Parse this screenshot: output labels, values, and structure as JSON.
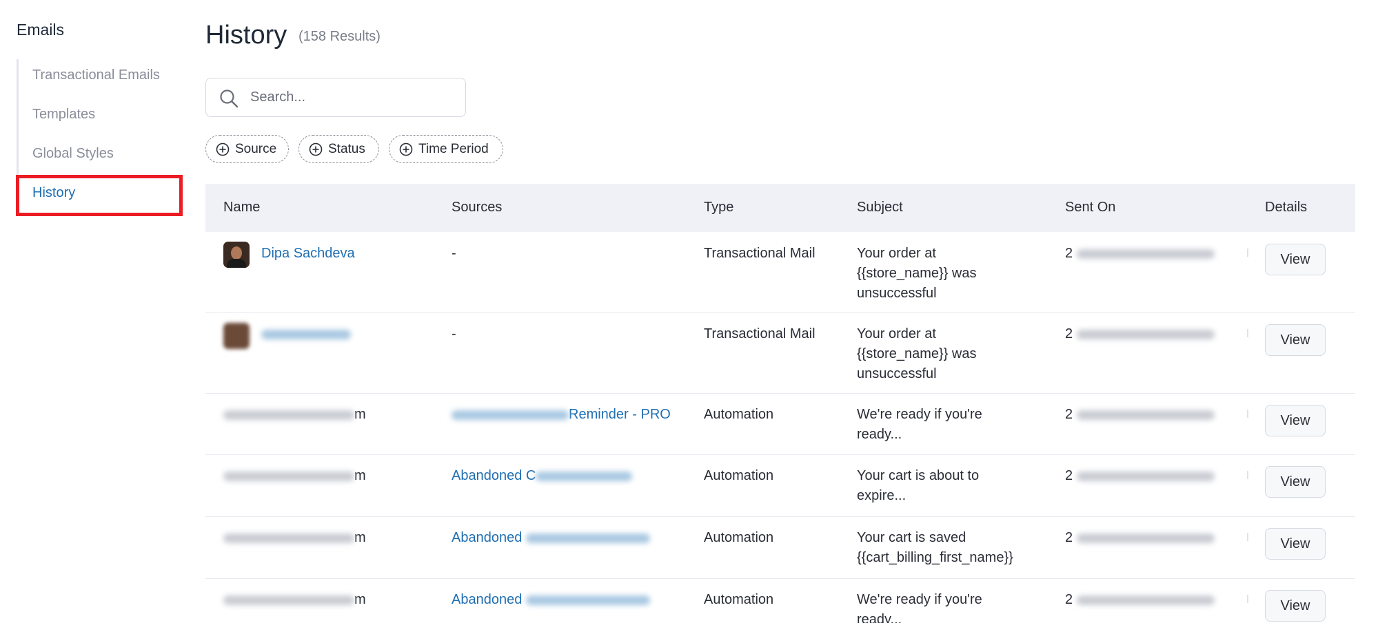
{
  "sidebar": {
    "heading": "Emails",
    "items": [
      {
        "label": "Transactional Emails",
        "active": false
      },
      {
        "label": "Templates",
        "active": false
      },
      {
        "label": "Global Styles",
        "active": false
      },
      {
        "label": "History",
        "active": true
      }
    ]
  },
  "header": {
    "title": "History",
    "count": "(158 Results)"
  },
  "search": {
    "placeholder": "Search..."
  },
  "filters": [
    {
      "label": "Source",
      "icon": "plus-circle-icon"
    },
    {
      "label": "Status",
      "icon": "plus-circle-icon"
    },
    {
      "label": "Time Period",
      "icon": "plus-circle-icon"
    }
  ],
  "table": {
    "columns": [
      "Name",
      "Sources",
      "Type",
      "Subject",
      "Sent On",
      "Details"
    ],
    "rows": [
      {
        "name": "Dipa Sachdeva",
        "name_suffix": "",
        "source": "-",
        "source_prefix": "",
        "source_suffix": "",
        "type": "Transactional Mail",
        "subject": [
          "Your order at",
          "{{store_name}} was",
          "unsuccessful"
        ],
        "sent_prefix": "2",
        "details": "View"
      },
      {
        "name": "",
        "name_suffix": "",
        "source": "-",
        "source_prefix": "",
        "source_suffix": "",
        "type": "Transactional Mail",
        "subject": [
          "Your order at",
          "{{store_name}} was",
          "unsuccessful"
        ],
        "sent_prefix": "2",
        "details": "View"
      },
      {
        "name": "",
        "name_suffix": "m",
        "source": "",
        "source_prefix": "",
        "source_suffix": "Reminder - PRO",
        "type": "Automation",
        "subject": [
          "We're ready if you're",
          "ready..."
        ],
        "sent_prefix": "2",
        "details": "View"
      },
      {
        "name": "",
        "name_suffix": "m",
        "source": "",
        "source_prefix": "Abandoned C",
        "source_suffix": "",
        "type": "Automation",
        "subject": [
          "Your cart is about to",
          "expire..."
        ],
        "sent_prefix": "2",
        "details": "View"
      },
      {
        "name": "",
        "name_suffix": "m",
        "source": "",
        "source_prefix": "Abandoned",
        "source_suffix": "",
        "type": "Automation",
        "subject": [
          "Your cart is saved",
          "{{cart_billing_first_name}}"
        ],
        "sent_prefix": "2",
        "details": "View"
      },
      {
        "name": "",
        "name_suffix": "m",
        "source": "",
        "source_prefix": "Abandoned",
        "source_suffix": "",
        "type": "Automation",
        "subject": [
          "We're ready if you're",
          "ready..."
        ],
        "sent_prefix": "2",
        "details": "View"
      }
    ]
  },
  "colors": {
    "link": "#1f6fb2",
    "highlight_border": "#ec1c24",
    "header_bg": "#eff1f6"
  }
}
